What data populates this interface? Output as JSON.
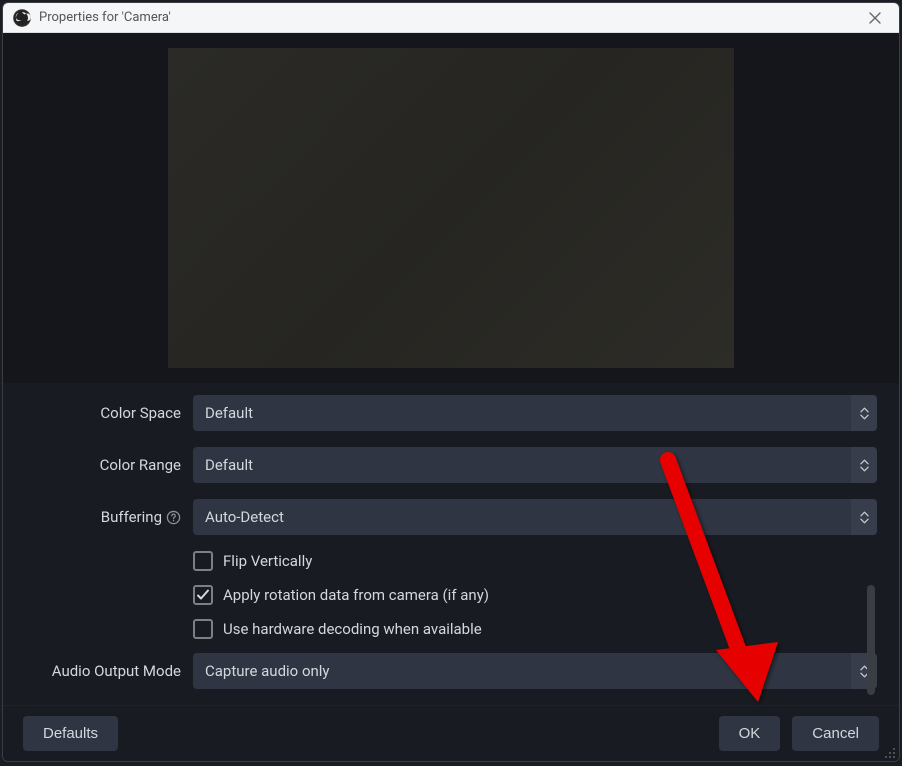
{
  "window": {
    "title": "Properties for 'Camera'"
  },
  "form": {
    "color_space": {
      "label": "Color Space",
      "value": "Default"
    },
    "color_range": {
      "label": "Color Range",
      "value": "Default"
    },
    "buffering": {
      "label": "Buffering",
      "value": "Auto-Detect"
    },
    "flip_vertically": {
      "label": "Flip Vertically",
      "checked": false
    },
    "apply_rotation": {
      "label": "Apply rotation data from camera (if any)",
      "checked": true
    },
    "hardware_decoding": {
      "label": "Use hardware decoding when available",
      "checked": false
    },
    "audio_output_mode": {
      "label": "Audio Output Mode",
      "value": "Capture audio only"
    }
  },
  "footer": {
    "defaults": "Defaults",
    "ok": "OK",
    "cancel": "Cancel"
  }
}
